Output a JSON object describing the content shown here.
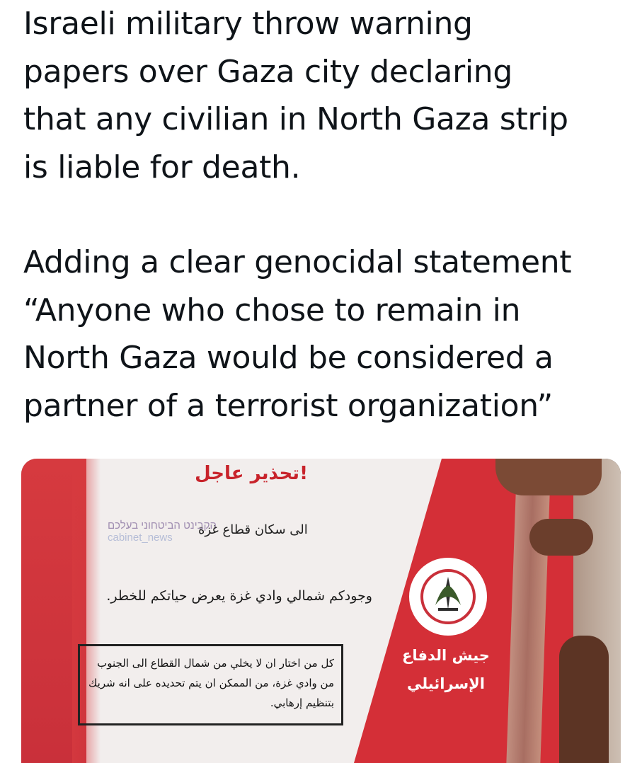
{
  "tweet": {
    "paragraph_1": "Israeli military throw warning\npapers over Gaza city declaring\nthat any civilian in North Gaza strip\nis liable for death.",
    "paragraph_2": "Adding a clear genocidal statement\n“Anyone who chose to remain in\nNorth Gaza would be considered a\npartner of a terrorist organization”"
  },
  "image": {
    "warning_title": "تحذير عاجل!",
    "address_line": "الى سكان قطاع غزة",
    "danger_line": "وجودكم شمالي وادي غزة يعرض حياتكم للخطر.",
    "box_text": "كل من اختار ان لا يخلي من شمال القطاع الى الجنوب من وادي غزة، من الممكن ان يتم تحديده على انه شريك بتنظيم إرهابي.",
    "watermark_he": "הקבינט הביטחוני בעלכם",
    "watermark_en": "cabinet_news",
    "signature": "جيش الدفاع الإسرائيلي",
    "emblem_icon": "idf-emblem-icon",
    "colors": {
      "paper_red": "#d42f37",
      "title_red": "#c8232b"
    }
  }
}
